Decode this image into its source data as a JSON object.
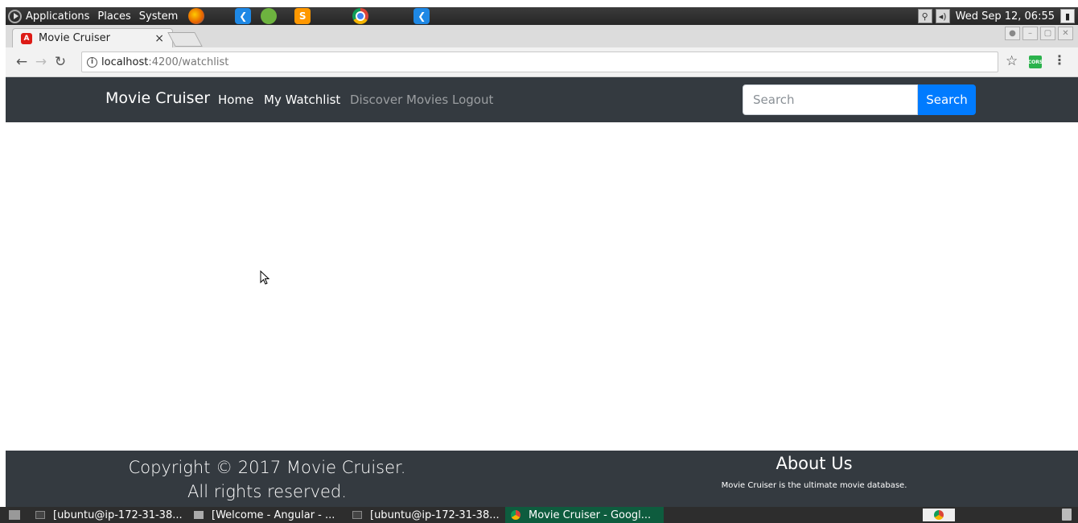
{
  "top_panel": {
    "menus": [
      "Applications",
      "Places",
      "System"
    ],
    "launchers": [
      "firefox-icon",
      "vscode-icon",
      "spring-icon",
      "sublime-text-icon",
      "chrome-icon",
      "vscode-icon"
    ],
    "clock": "Wed Sep 12, 06:55"
  },
  "browser": {
    "tab_title": "Movie Cruiser",
    "url_host": "localhost",
    "url_path": ":4200/watchlist",
    "extension_label": "CORS"
  },
  "navbar": {
    "brand": "Movie Cruiser",
    "links": [
      {
        "label": "Home",
        "active": true
      },
      {
        "label": "My Watchlist",
        "active": true
      },
      {
        "label": "Discover Movies",
        "active": false
      },
      {
        "label": "Logout",
        "active": false
      }
    ],
    "search_placeholder": "Search",
    "search_button": "Search",
    "accent_color": "#007bff",
    "bar_color": "#343a40"
  },
  "footer": {
    "copyright_line1": "Copyright © 2017 Movie Cruiser.",
    "copyright_line2": "All rights reserved.",
    "about_title": "About Us",
    "about_text": "Movie Cruiser is the ultimate movie database."
  },
  "taskbar": {
    "tasks": [
      {
        "label": "[ubuntu@ip-172-31-38...",
        "icon": "terminal-icon",
        "active": false
      },
      {
        "label": "[Welcome - Angular - ...",
        "icon": "files-icon",
        "active": false
      },
      {
        "label": "[ubuntu@ip-172-31-38...",
        "icon": "terminal-icon",
        "active": false
      },
      {
        "label": "Movie Cruiser - Googl...",
        "icon": "chrome-icon",
        "active": true
      }
    ]
  }
}
